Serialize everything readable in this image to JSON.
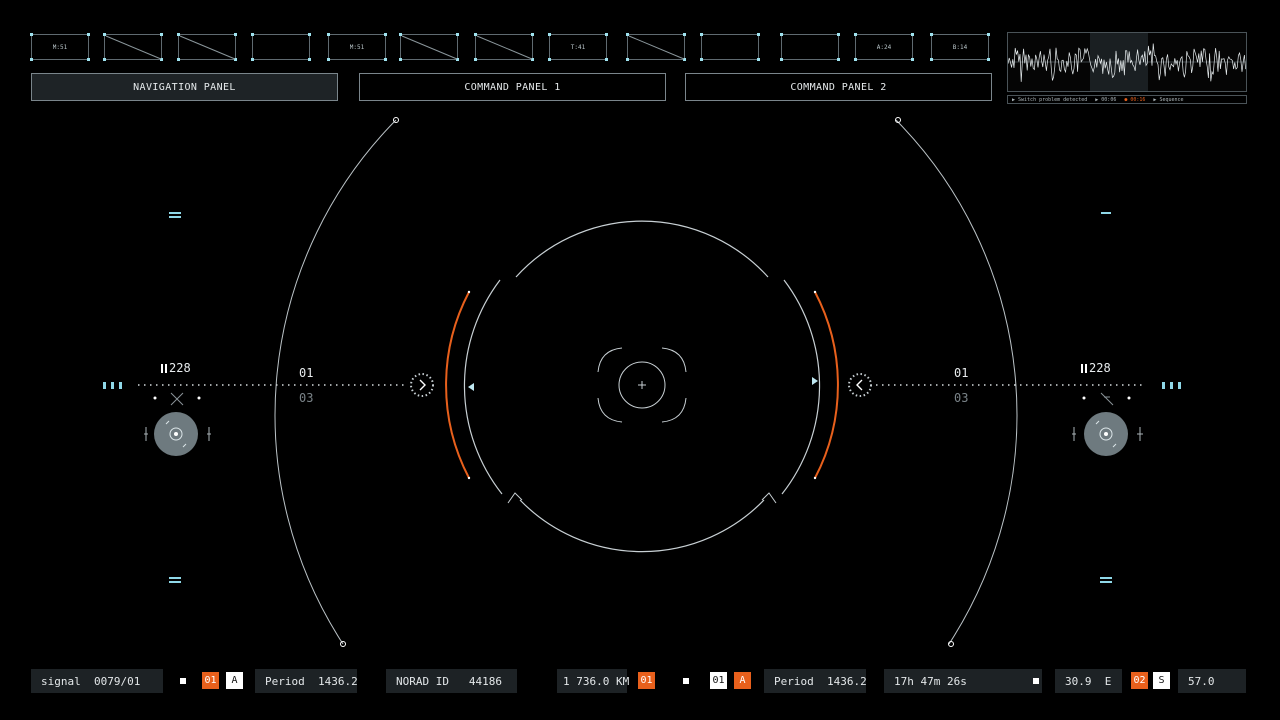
{
  "thumbnails": [
    {
      "label": "M:51",
      "slash": false
    },
    {
      "label": "",
      "slash": true
    },
    {
      "label": "",
      "slash": true
    },
    {
      "label": "",
      "slash": false
    },
    {
      "label": "M:51",
      "slash": false
    },
    {
      "label": "",
      "slash": true
    },
    {
      "label": "",
      "slash": true
    },
    {
      "label": "T:41",
      "slash": false
    },
    {
      "label": "",
      "slash": true
    },
    {
      "label": "",
      "slash": false
    },
    {
      "label": "",
      "slash": false
    },
    {
      "label": "A:24",
      "slash": false
    },
    {
      "label": "B:14",
      "slash": false
    }
  ],
  "tabs": [
    {
      "label": "NAVIGATION PANEL",
      "active": true
    },
    {
      "label": "COMMAND PANEL 1",
      "active": false
    },
    {
      "label": "COMMAND PANEL 2",
      "active": false
    }
  ],
  "waveform": {
    "status": [
      "▶ Switch problem detected",
      "▶ 00:06",
      "● 00:16",
      "▶ Sequence"
    ],
    "alert_color": "#e8601c"
  },
  "left": {
    "counter": "228",
    "primary": "01",
    "secondary": "03"
  },
  "right": {
    "counter": "228",
    "primary": "01",
    "secondary": "03"
  },
  "bottom": {
    "signal": "signal  0079/01",
    "tag1": "01",
    "tag2": "A",
    "period1": "Period  1436.2",
    "norad": "NORAD ID   44186",
    "distance": "1 736.0 KM",
    "tag3": "01",
    "tag4": "01",
    "tag5": "A",
    "period2": "Period  1436.2",
    "time": "17h 47m 26s",
    "heading": "30.9  E",
    "tag6": "02",
    "tag7": "S",
    "value": "57.0"
  },
  "colors": {
    "accent": "#e8601c",
    "cyan": "#8fd8e8",
    "line": "#c8d0d4",
    "panel": "#1d2225"
  },
  "icons": [
    "chevron-right-icon",
    "chevron-left-icon",
    "triangle-left-icon",
    "triangle-right-icon",
    "crosshair-icon",
    "disc-icon",
    "equals-icon"
  ]
}
